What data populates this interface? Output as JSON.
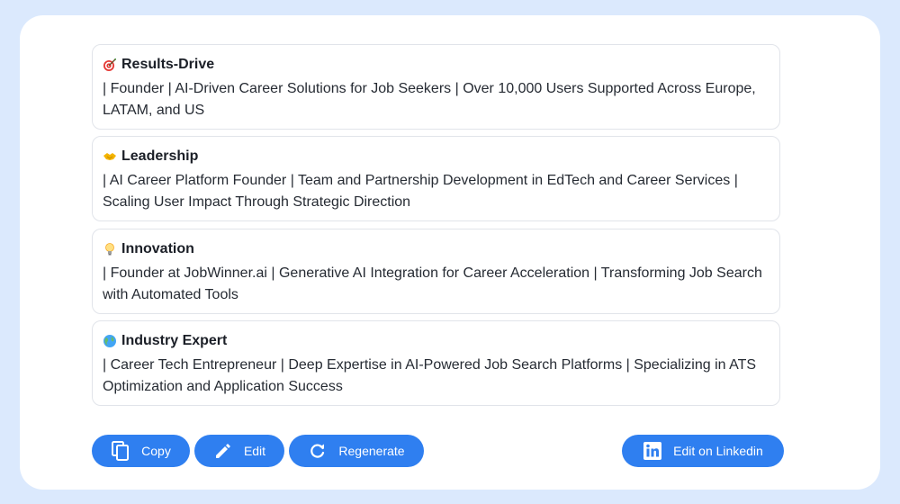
{
  "cards": [
    {
      "icon": "target-icon",
      "title": "Results-Drive",
      "text": "| Founder | AI-Driven Career Solutions for Job Seekers | Over 10,000 Users Supported Across Europe, LATAM, and US"
    },
    {
      "icon": "handshake-icon",
      "title": "Leadership",
      "text": "| AI Career Platform Founder | Team and Partnership Development in EdTech and Career Services | Scaling User Impact Through Strategic Direction"
    },
    {
      "icon": "lightbulb-icon",
      "title": "Innovation",
      "text": "| Founder at JobWinner.ai | Generative AI Integration for Career Acceleration | Transforming Job Search with Automated Tools"
    },
    {
      "icon": "globe-icon",
      "title": "Industry Expert",
      "text": "| Career Tech Entrepreneur | Deep Expertise in AI-Powered Job Search Platforms | Specializing in ATS Optimization and Application Success"
    }
  ],
  "actions": {
    "copy": "Copy",
    "edit": "Edit",
    "regenerate": "Regenerate",
    "linkedin": "Edit on Linkedin"
  },
  "colors": {
    "accent": "#2f7ff0",
    "background": "#dbe9fd"
  }
}
